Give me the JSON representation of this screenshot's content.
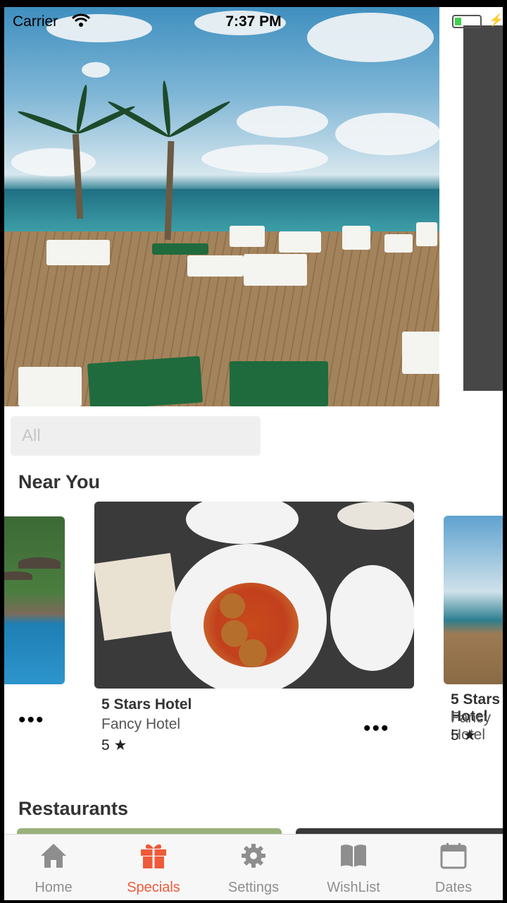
{
  "status_bar": {
    "carrier": "Carrier",
    "time": "7:37 PM"
  },
  "search": {
    "placeholder": "All"
  },
  "sections": {
    "near_you": "Near You",
    "restaurants": "Restaurants"
  },
  "cards": [
    {
      "title": "5 Stars Hotel",
      "subtitle": "Fancy Hotel",
      "rating": "5 ★"
    },
    {
      "title": "5 Stars Hotel",
      "subtitle": "Fancy Hotel",
      "rating": "5 ★"
    }
  ],
  "more_glyph": "•••",
  "tabs": [
    {
      "label": "Home",
      "icon": "home-icon"
    },
    {
      "label": "Specials",
      "icon": "gift-icon",
      "active": true
    },
    {
      "label": "Settings",
      "icon": "gear-icon"
    },
    {
      "label": "WishList",
      "icon": "book-icon"
    },
    {
      "label": "Dates",
      "icon": "calendar-icon"
    }
  ],
  "colors": {
    "accent": "#ef5a3a",
    "tab_inactive": "#8e8e8e",
    "search_bg": "#efefef"
  }
}
